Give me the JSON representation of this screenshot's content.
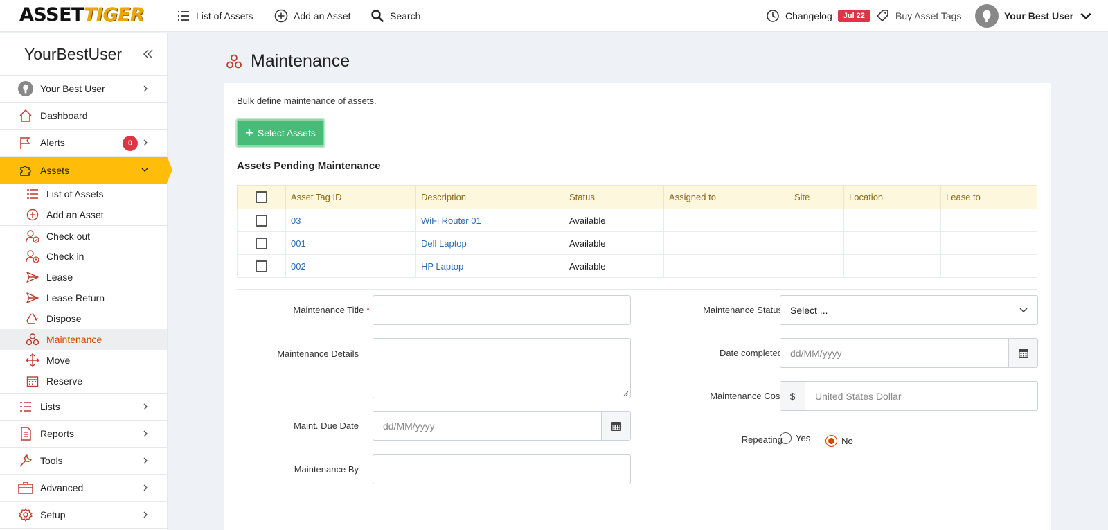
{
  "topnav": {
    "logo_a": "ASSET",
    "logo_t": "TIGER",
    "list_assets": "List of Assets",
    "add_asset": "Add an Asset",
    "search": "Search",
    "changelog": "Changelog",
    "changelog_badge": "Jul 22",
    "buy_tags": "Buy Asset Tags",
    "user": "Your Best User"
  },
  "sidebar": {
    "title": "YourBestUser",
    "user": "Your Best User",
    "dashboard": "Dashboard",
    "alerts": "Alerts",
    "alerts_count": "0",
    "assets": "Assets",
    "sub": [
      "List of Assets",
      "Add an Asset",
      "Check out",
      "Check in",
      "Lease",
      "Lease Return",
      "Dispose",
      "Maintenance",
      "Move",
      "Reserve"
    ],
    "lists": "Lists",
    "reports": "Reports",
    "tools": "Tools",
    "advanced": "Advanced",
    "setup": "Setup"
  },
  "main": {
    "title": "Maintenance",
    "intro": "Bulk define maintenance of assets.",
    "select_btn": "Select Assets",
    "section": "Assets Pending Maintenance",
    "columns": [
      "Asset Tag ID",
      "Description",
      "Status",
      "Assigned to",
      "Site",
      "Location",
      "Lease to"
    ],
    "rows": [
      {
        "tag": "03",
        "desc": "WiFi Router 01",
        "status": "Available"
      },
      {
        "tag": "001",
        "desc": "Dell Laptop",
        "status": "Available"
      },
      {
        "tag": "002",
        "desc": "HP Laptop",
        "status": "Available"
      }
    ]
  },
  "form": {
    "title_label": "Maintenance Title",
    "req": "*",
    "details_label": "Maintenance Details",
    "due_label": "Maint. Due Date",
    "due_ph": "dd/MM/yyyy",
    "by_label": "Maintenance By",
    "status_label": "Maintenance Status",
    "status_val": "Select ...",
    "completed_label": "Date completed",
    "completed_ph": "dd/MM/yyyy",
    "cost_label": "Maintenance Cost",
    "cost_prefix": "$",
    "cost_ph": "United States Dollar",
    "repeat_label": "Repeating",
    "yes": "Yes",
    "no": "No"
  }
}
